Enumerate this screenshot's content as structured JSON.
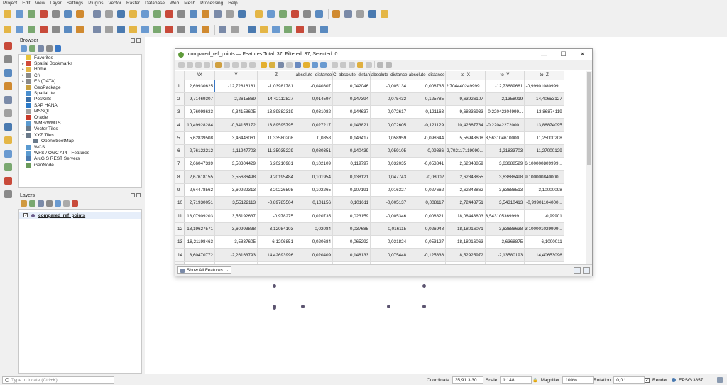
{
  "menu": [
    "Project",
    "Edit",
    "View",
    "Layer",
    "Settings",
    "Plugins",
    "Vector",
    "Raster",
    "Database",
    "Web",
    "Mesh",
    "Processing",
    "Help"
  ],
  "toolbar1": [
    "new-project-icon",
    "open-project-icon",
    "save-project-icon",
    "save-as-icon",
    "print-layout-icon",
    "layout-manager-icon",
    "style-manager-icon",
    "pan-icon",
    "pan-to-selection-icon",
    "zoom-in-icon",
    "zoom-out-icon",
    "zoom-rubber-icon",
    "zoom-full-icon",
    "zoom-selection-icon",
    "zoom-layer-icon",
    "zoom-last-icon",
    "zoom-next-icon",
    "new-map-view-icon",
    "temporal-controller-icon",
    "refresh-icon",
    "identify-icon",
    "select-features-icon",
    "deselect-icon",
    "field-calculator-icon",
    "statistics-icon",
    "sum-icon",
    "open-attribute-table-icon",
    "measure-icon",
    "annotation-icon",
    "tips-icon",
    "map-tips-icon"
  ],
  "toolbar2": [
    "digitize-icon",
    "data-source-manager-icon",
    "new-geopackage-icon",
    "new-shapefile-icon",
    "add-vector-icon",
    "add-raster-icon",
    "add-wms-icon",
    "toggle-editing-icon",
    "save-edits-icon",
    "add-feature-icon",
    "vertex-tool-icon",
    "delete-selected-icon",
    "cut-features-icon",
    "copy-features-icon",
    "paste-features-icon",
    "undo-icon",
    "redo-icon",
    "python-console-icon",
    "plugin-icon",
    "label-icon",
    "pin-labels-icon",
    "show-labels-icon",
    "move-label-icon",
    "rotate-label-icon",
    "label-change-icon",
    "text-annotation-icon"
  ],
  "vtools": [
    "add-vector-layer-icon",
    "add-raster-layer-icon",
    "add-mesh-layer-icon",
    "add-delimited-text-icon",
    "add-spatialite-icon",
    "add-postgis-icon",
    "add-mssql-icon",
    "add-oracle-icon",
    "add-wms-layer-icon",
    "add-wcs-layer-icon",
    "add-wfs-layer-icon",
    "add-virtual-layer-icon"
  ],
  "browser": {
    "title": "Browser",
    "items": [
      {
        "label": "Favorites",
        "arrow": "",
        "color": "#e8c33a",
        "indent": 0
      },
      {
        "label": "Spatial Bookmarks",
        "arrow": "▸",
        "color": "#d04a3a",
        "indent": 0
      },
      {
        "label": "Home",
        "arrow": "▸",
        "color": "#e4b646",
        "indent": 0
      },
      {
        "label": "C:\\",
        "arrow": "▸",
        "color": "#8a8a8a",
        "indent": 0
      },
      {
        "label": "E:\\ (DATA)",
        "arrow": "▸",
        "color": "#8a8a8a",
        "indent": 0
      },
      {
        "label": "GeoPackage",
        "arrow": "",
        "color": "#c8a040",
        "indent": 0
      },
      {
        "label": "SpatiaLite",
        "arrow": "",
        "color": "#4a8fcf",
        "indent": 0
      },
      {
        "label": "PostGIS",
        "arrow": "",
        "color": "#3a6fa8",
        "indent": 0
      },
      {
        "label": "SAP HANA",
        "arrow": "",
        "color": "#2a7ac8",
        "indent": 0
      },
      {
        "label": "MSSQL",
        "arrow": "",
        "color": "#a0a0a0",
        "indent": 0
      },
      {
        "label": "Oracle",
        "arrow": "",
        "color": "#c83a2a",
        "indent": 0
      },
      {
        "label": "WMS/WMTS",
        "arrow": "",
        "color": "#5a9ad0",
        "indent": 0
      },
      {
        "label": "Vector Tiles",
        "arrow": "",
        "color": "#6a7a8a",
        "indent": 0
      },
      {
        "label": "XYZ Tiles",
        "arrow": "▾",
        "color": "#6a7a8a",
        "indent": 0
      },
      {
        "label": "OpenStreetMap",
        "arrow": "",
        "color": "#6a7a8a",
        "indent": 1
      },
      {
        "label": "WCS",
        "arrow": "",
        "color": "#5a9ad0",
        "indent": 0
      },
      {
        "label": "WFS / OGC API - Features",
        "arrow": "",
        "color": "#5a9ad0",
        "indent": 0
      },
      {
        "label": "ArcGIS REST Servers",
        "arrow": "",
        "color": "#4a7ab0",
        "indent": 0
      },
      {
        "label": "GeoNode",
        "arrow": "",
        "color": "#6a9a5a",
        "indent": 0
      }
    ]
  },
  "layers": {
    "title": "Layers",
    "layer_name": "compared_ref_points",
    "checked": "✓"
  },
  "attr": {
    "title": "compared_ref_points — Features Total: 37, Filtered: 37, Selected: 0",
    "columns": [
      "//X",
      "Y",
      "Z",
      "absolute_distance",
      "C_absolute_distan",
      "absolute_distance",
      "absolute_distance",
      "to_X",
      "to_Y",
      "to_Z"
    ],
    "rows": [
      [
        "1",
        "2,69930625",
        "-12,72816181",
        "-1,03981781",
        "-0,040807",
        "0,042046",
        "-0,005134",
        "0,008735",
        "2,704440249999...",
        "-12,73689681",
        "-0,99901080999..."
      ],
      [
        "2",
        "9,71469307",
        "-2,2615869",
        "14,42112827",
        "0,014597",
        "0,147394",
        "0,075432",
        "-0,125785",
        "9,63926107",
        "-2,1358019",
        "14,40653127"
      ],
      [
        "3",
        "9,76098633",
        "-0,34158605",
        "13,89882319",
        "0,031082",
        "0,144637",
        "0,072617",
        "-0,121163",
        "9,68836933",
        "-0,22042304999...",
        "13,86874119"
      ],
      [
        "4",
        "10,49928284",
        "-0,34155172",
        "13,89595795",
        "0,027217",
        "0,143821",
        "0,072605",
        "-0,121129",
        "10,42667784",
        "-0,22042272000...",
        "13,86874095"
      ],
      [
        "5",
        "5,62839508",
        "3,46446061",
        "11,33580208",
        "0,0858",
        "0,143417",
        "0,058959",
        "-0,098644",
        "5,56943608",
        "3,563104610000...",
        "11,25000208"
      ],
      [
        "6",
        "2,76122212",
        "1,11947703",
        "11,35035229",
        "0,080351",
        "0,140439",
        "0,059105",
        "-0,09886",
        "2,702117119999...",
        "1,21833703",
        "11,27000129"
      ],
      [
        "7",
        "2,66047339",
        "3,58304429",
        "6,20210981",
        "0,102109",
        "0,119797",
        "0,032035",
        "-0,053841",
        "2,62843859",
        "3,63688529",
        "6,100000809999..."
      ],
      [
        "8",
        "2,67618155",
        "3,55686498",
        "9,20195484",
        "0,101954",
        "0,138121",
        "0,047743",
        "-0,08002",
        "2,62843855",
        "3,63688498",
        "9,100000840000..."
      ],
      [
        "9",
        "2,64478562",
        "3,60922313",
        "3,20226598",
        "0,102265",
        "0,107191",
        "0,016327",
        "-0,027662",
        "2,62843862",
        "3,63688513",
        "3,10000098"
      ],
      [
        "10",
        "2,71930051",
        "3,55122113",
        "-0,89785504",
        "0,101156",
        "0,101611",
        "-0,005137",
        "0,008117",
        "2,72443751",
        "3,54310413",
        "-0,99901104000..."
      ],
      [
        "11",
        "18,07909203",
        "3,55192637",
        "-0,978275",
        "0,020735",
        "0,023159",
        "-0,005346",
        "0,008821",
        "18,08443803",
        "3,543105369999...",
        "-0,99901"
      ],
      [
        "12",
        "18,19627571",
        "3,60993838",
        "3,12084103",
        "0,02084",
        "0,037685",
        "0,016115",
        "-0,026948",
        "18,18016071",
        "3,63688638",
        "3,100001029999..."
      ],
      [
        "13",
        "18,21198463",
        "3,5837605",
        "6,1206851",
        "0,020684",
        "0,065292",
        "0,031824",
        "-0,053127",
        "18,18016063",
        "3,6368875",
        "6,1000011"
      ],
      [
        "14",
        "8,60470772",
        "-2,26163793",
        "14,42693996",
        "0,020409",
        "0,148133",
        "0,075448",
        "-0,125836",
        "8,52925972",
        "-2,13580193",
        "14,40653096"
      ],
      [
        "15",
        "18,22769165",
        "3,55758071",
        "9,12053013",
        "0,02053",
        "0,094711",
        "0,047531",
        "-0,079307",
        "18,18016065",
        "3,63688771",
        "9,10000013"
      ],
      [
        "16",
        "14,4967947",
        "3,46486926",
        "11,28936863",
        "0,039368",
        "0,121088",
        "0,058839",
        "-0,098237",
        "14,4379557",
        "3,56310626",
        "11,25000063"
      ],
      [
        "17",
        "",
        "",
        "",
        "",
        "",
        "",
        "",
        "",
        "",
        ""
      ]
    ],
    "show_all": "Show All Features"
  },
  "status": {
    "locator_placeholder": "Type to locate (Ctrl+K)",
    "coordinate_label": "Coordinate",
    "coordinate_value": "35,91 3,30",
    "scale_label": "Scale",
    "scale_value": "1:148",
    "magnifier_label": "Magnifier",
    "magnifier_value": "100%",
    "rotation_label": "Rotation",
    "rotation_value": "0,0 °",
    "render_label": "Render",
    "crs": "EPSG:3857"
  },
  "colors": {
    "accent": "#3a78c5",
    "point": "#5c5470",
    "qgis_green": "#5f9b3a"
  }
}
